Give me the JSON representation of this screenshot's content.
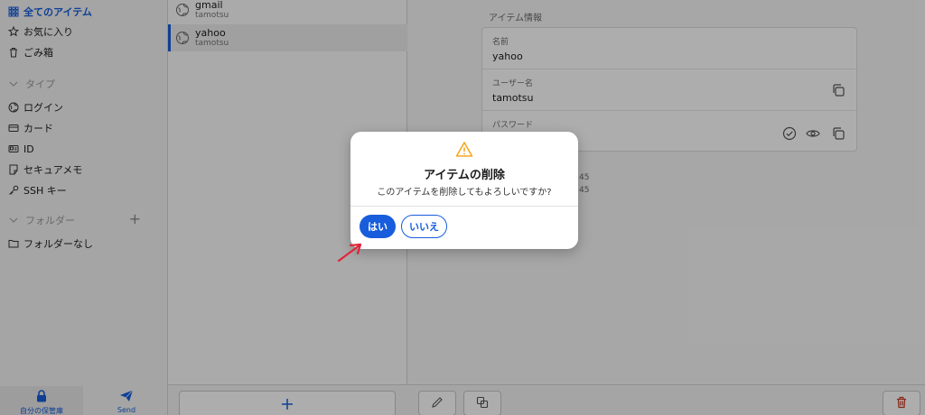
{
  "sidebar": {
    "all_items": "全てのアイテム",
    "favorites": "お気に入り",
    "trash": "ごみ箱",
    "types_header": "タイプ",
    "types": [
      "ログイン",
      "カード",
      "ID",
      "セキュアメモ",
      "SSH キー"
    ],
    "folders_header": "フォルダー",
    "no_folder": "フォルダーなし",
    "footer": {
      "vault_label": "自分の保管庫",
      "send_label": "Send"
    }
  },
  "list": {
    "items": [
      {
        "name": "gmail",
        "user": "tamotsu"
      },
      {
        "name": "yahoo",
        "user": "tamotsu"
      }
    ],
    "add_icon": "plus-icon"
  },
  "detail": {
    "section_title": "アイテム情報",
    "name_label": "名前",
    "name_value": "yahoo",
    "username_label": "ユーザー名",
    "username_value": "tamotsu",
    "password_label": "パスワード",
    "history_1": "45",
    "history_2": "45"
  },
  "modal": {
    "title": "アイテムの削除",
    "message": "このアイテムを削除してもよろしいですか?",
    "yes": "はい",
    "no": "いいえ"
  },
  "colors": {
    "accent": "#175ddc",
    "warning": "#f5a623",
    "annotation_arrow": "#e0243a"
  }
}
